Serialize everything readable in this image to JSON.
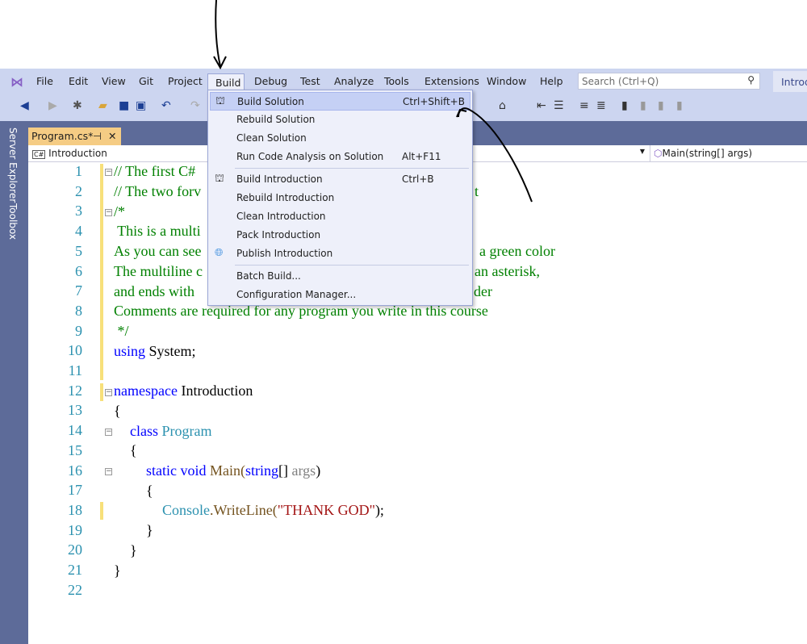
{
  "menubar": {
    "items": [
      "File",
      "Edit",
      "View",
      "Git",
      "Project",
      "Build",
      "Debug",
      "Test",
      "Analyze",
      "Tools",
      "Extensions",
      "Window",
      "Help"
    ],
    "search_placeholder": "Search (Ctrl+Q)",
    "project_badge": "Introd"
  },
  "side": {
    "server_explorer": "Server Explorer",
    "toolbox": "Toolbox"
  },
  "tab": {
    "label": "Program.cs*",
    "pin": "⊣",
    "close": "✕"
  },
  "nav": {
    "left": "Introduction",
    "right": "Main(string[] args)"
  },
  "build_menu": {
    "items": [
      {
        "label": "Build Solution",
        "shortcut": "Ctrl+Shift+B",
        "icon": "build-icon"
      },
      {
        "label": "Rebuild Solution",
        "shortcut": ""
      },
      {
        "label": "Clean Solution",
        "shortcut": ""
      },
      {
        "label": "Run Code Analysis on Solution",
        "shortcut": "Alt+F11"
      },
      {
        "label": "Build Introduction",
        "shortcut": "Ctrl+B",
        "icon": "build-icon"
      },
      {
        "label": "Rebuild Introduction",
        "shortcut": ""
      },
      {
        "label": "Clean Introduction",
        "shortcut": ""
      },
      {
        "label": "Pack Introduction",
        "shortcut": ""
      },
      {
        "label": "Publish Introduction",
        "shortcut": "",
        "icon": "globe-icon"
      },
      {
        "label": "Batch Build...",
        "shortcut": ""
      },
      {
        "label": "Configuration Manager...",
        "shortcut": ""
      }
    ]
  },
  "code": {
    "l1": "// The first C#",
    "l2a": "// The two forv",
    "l2b": "t",
    "l3": "/*",
    "l4": " This is a multi",
    "l5a": "As you can see",
    "l5b": "a green color",
    "l6a": "The multiline c",
    "l6b": "an asterisk,",
    "l7a": "and ends with",
    "l7b": "der",
    "l8": "Comments are required for any program you write in this course",
    "l9": " */",
    "using": "using",
    "system": " System;",
    "namespace": "namespace",
    "ns": " Introduction",
    "ob": "{",
    "class": "class",
    "prog": " Program",
    "static": "static void",
    "main": " Main(",
    "string": "string",
    "brk": "[] ",
    "args": "args",
    "cp": ")",
    "console": "Console",
    "wl": ".WriteLine(",
    "str": "\"THANK GOD\"",
    "end": ");",
    "cb": "}"
  }
}
